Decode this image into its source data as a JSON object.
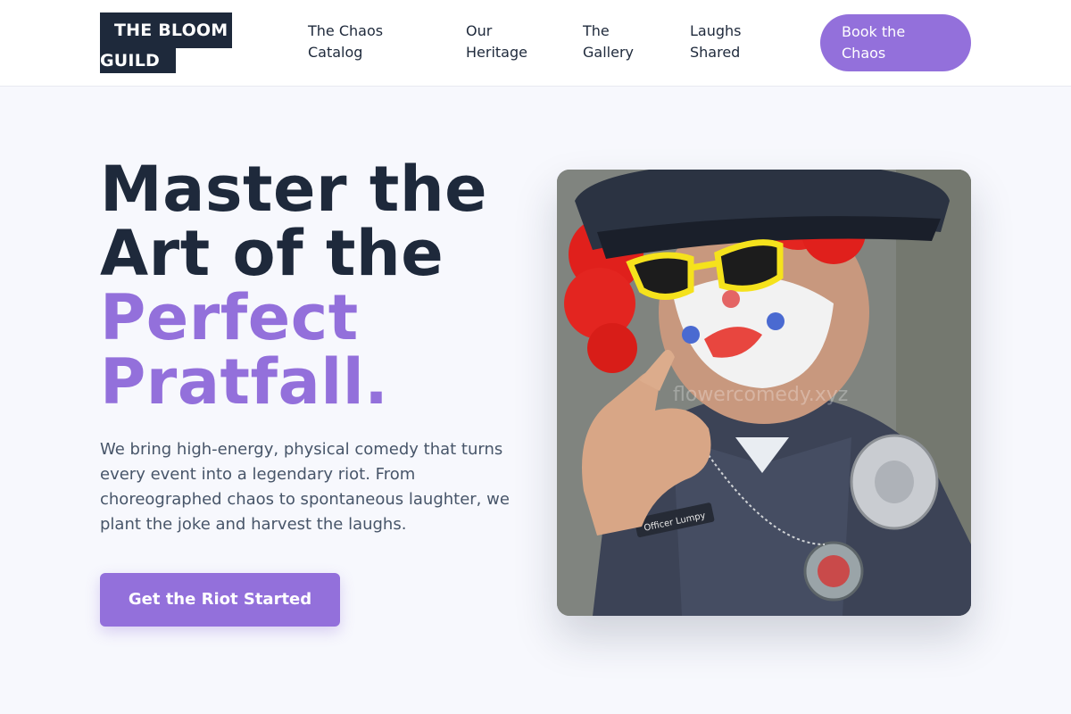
{
  "header": {
    "logo_line1": "THE BLOOM",
    "logo_line2": "GUILD",
    "nav": [
      {
        "line1": "The Chaos",
        "line2": "Catalog"
      },
      {
        "line1": "Our",
        "line2": "Heritage"
      },
      {
        "line1": "The",
        "line2": "Gallery"
      },
      {
        "line1": "Laughs",
        "line2": "Shared"
      }
    ],
    "cta": {
      "line1": "Book the",
      "line2": "Chaos"
    }
  },
  "hero": {
    "title_line1": "Master the",
    "title_line2": "Art of the",
    "title_accent1": "Perfect",
    "title_accent2": "Pratfall.",
    "description": "We bring high-energy, physical comedy that turns every event into a legendary riot. From choreographed chaos to spontaneous laughter, we plant the joke and harvest the laughs.",
    "cta_label": "Get the Riot Started"
  },
  "photo": {
    "watermark": "flowercomedy.xyz",
    "badge_text": "Officer Lumpy"
  },
  "colors": {
    "accent": "#9370db",
    "dark": "#1e293b",
    "background": "#f7f8fd",
    "text_muted": "#475569"
  }
}
